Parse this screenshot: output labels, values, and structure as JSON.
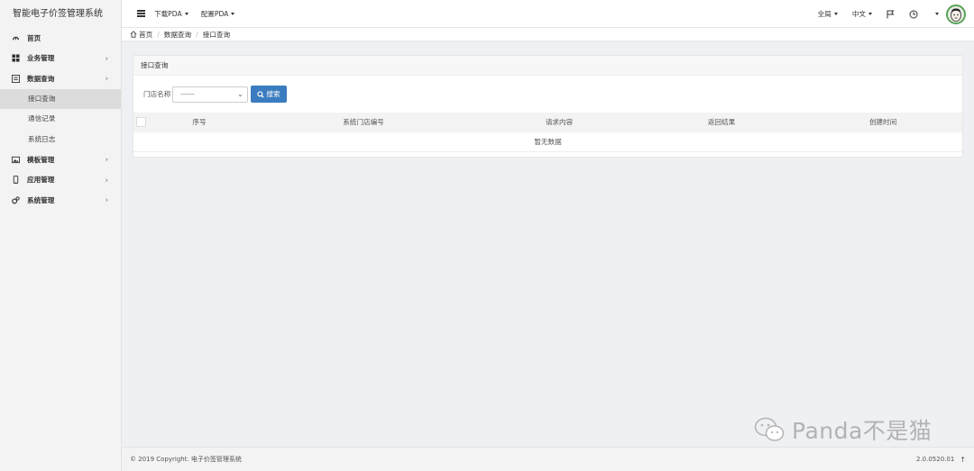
{
  "app": {
    "title": "智能电子价签管理系统"
  },
  "sidebar": {
    "items": [
      {
        "label": "首页",
        "icon": "dashboard-icon"
      },
      {
        "label": "业务管理",
        "icon": "grid-icon"
      },
      {
        "label": "数据查询",
        "icon": "list-icon"
      },
      {
        "label": "模板管理",
        "icon": "image-icon"
      },
      {
        "label": "应用管理",
        "icon": "mobile-icon"
      },
      {
        "label": "系统管理",
        "icon": "cogs-icon"
      }
    ],
    "subitems": [
      {
        "label": "接口查询"
      },
      {
        "label": "通信记录"
      },
      {
        "label": "系统日志"
      }
    ]
  },
  "topbar": {
    "download_pda": "下载PDA",
    "config_pda": "配置PDA",
    "scope": "全局",
    "language": "中文"
  },
  "breadcrumb": {
    "home": "首页",
    "level1": "数据查询",
    "level2": "接口查询"
  },
  "panel": {
    "title": "接口查询",
    "filter_label": "门店名称",
    "select_value": "------",
    "search_button": "搜索"
  },
  "table": {
    "columns": [
      "序号",
      "系统门店编号",
      "请求内容",
      "返回结果",
      "创建时间"
    ],
    "empty_text": "暂无数据"
  },
  "watermark": {
    "text": "Panda不是猫"
  },
  "footer": {
    "copyright": "© 2019 Copyright. 电子价签管理系统",
    "version": "2.0.0520.01"
  },
  "colors": {
    "primary": "#3a7cbf",
    "sidebar_bg": "#f3f3f3",
    "active_bg": "#dcdcdc"
  }
}
